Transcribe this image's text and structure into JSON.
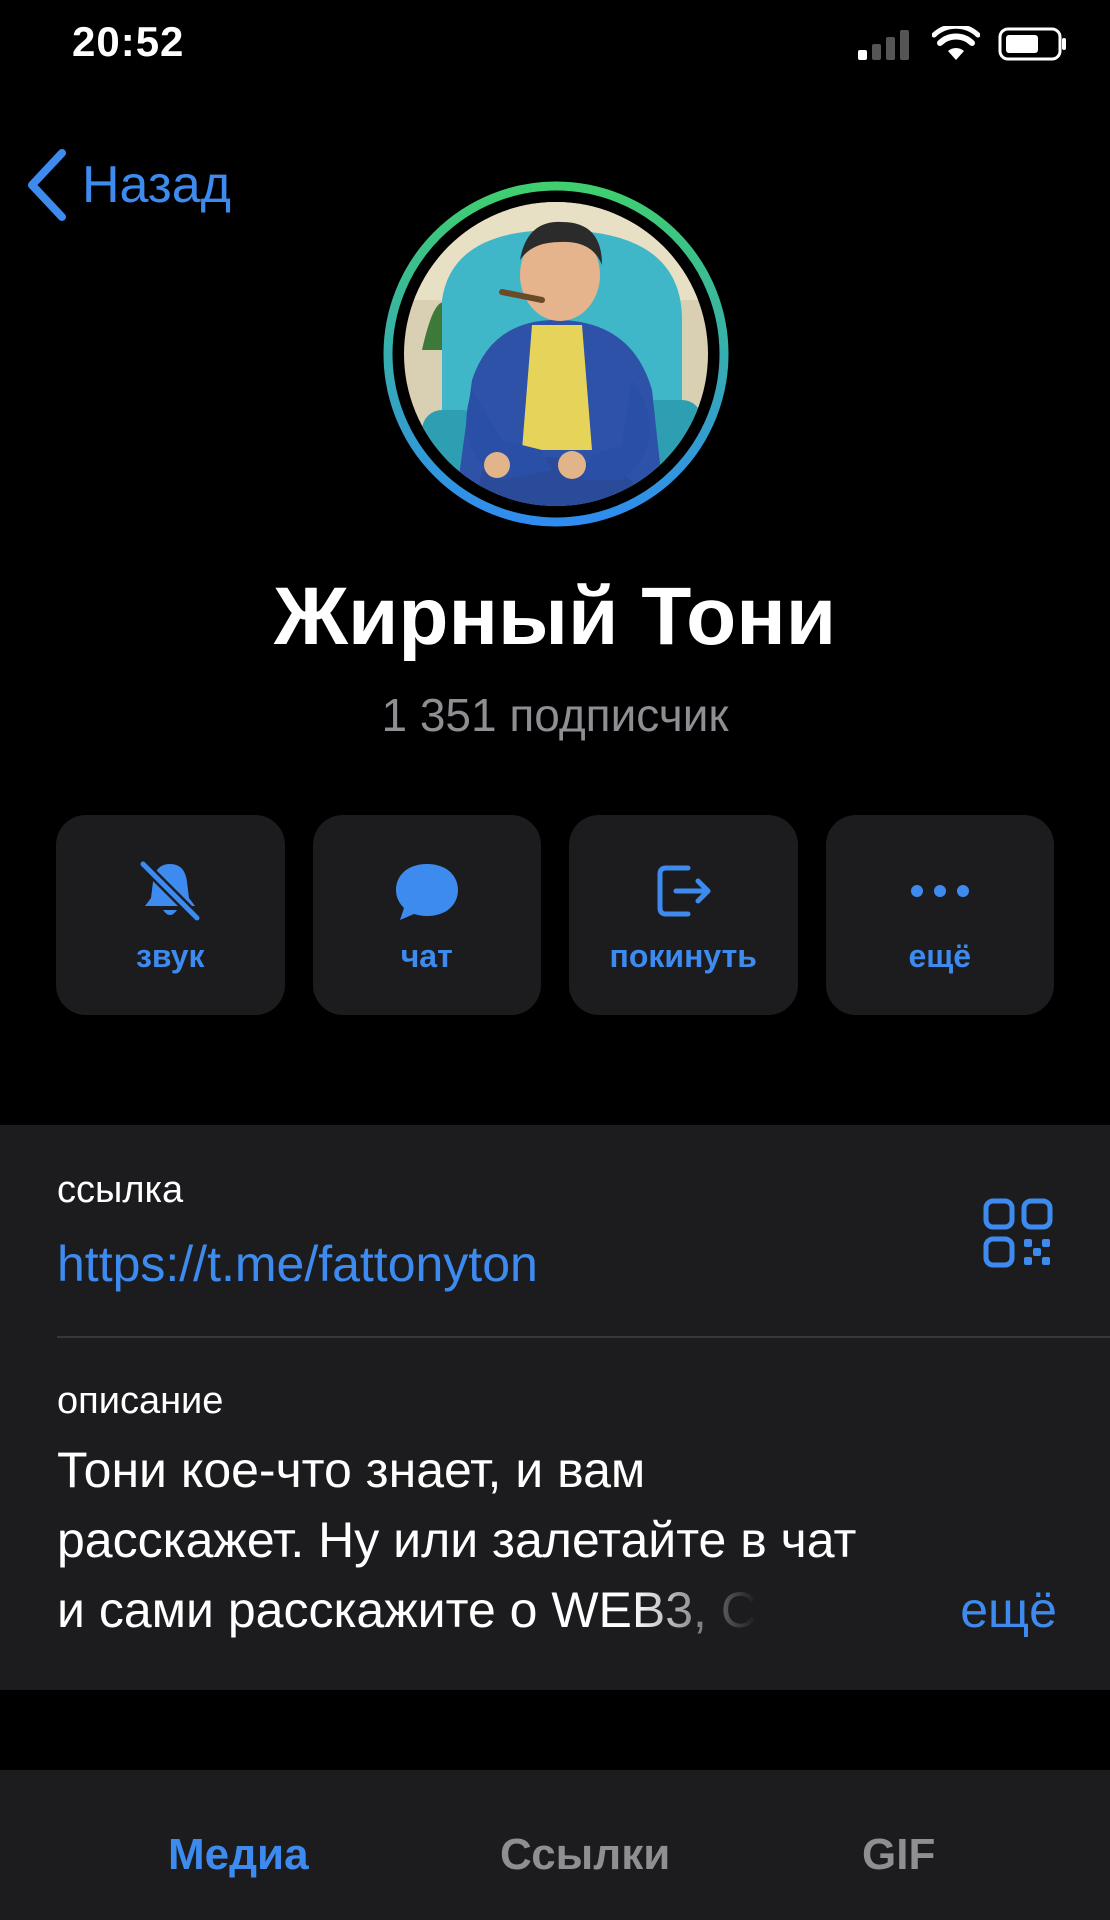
{
  "status_bar": {
    "time": "20:52",
    "icons": [
      "signal-icon",
      "wifi-icon",
      "battery-icon"
    ]
  },
  "nav": {
    "back_label": "Назад"
  },
  "channel": {
    "name": "Жирный Тони",
    "subscribers": "1 351 подписчик"
  },
  "actions": [
    {
      "label": "звук",
      "icon": "bell-muted-icon"
    },
    {
      "label": "чат",
      "icon": "chat-bubble-icon"
    },
    {
      "label": "покинуть",
      "icon": "leave-icon"
    },
    {
      "label": "ещё",
      "icon": "more-dots-icon"
    }
  ],
  "info": {
    "link_label": "ссылка",
    "link_value": "https://t.me/fattonyton",
    "description_label": "описание",
    "description_lines": [
      "Тони кое-что знает, и вам",
      "расскажет. Ну или залетайте в чат",
      "и сами расскажите о WEB3, С"
    ],
    "more_label": "ещё"
  },
  "tabs": [
    {
      "label": "Медиа",
      "active": true
    },
    {
      "label": "Ссылки",
      "active": false
    },
    {
      "label": "GIF",
      "active": false
    }
  ],
  "colors": {
    "accent": "#3e8bf0",
    "background": "#000000",
    "card": "#1c1c1e",
    "secondary_text": "#8e8e93"
  }
}
